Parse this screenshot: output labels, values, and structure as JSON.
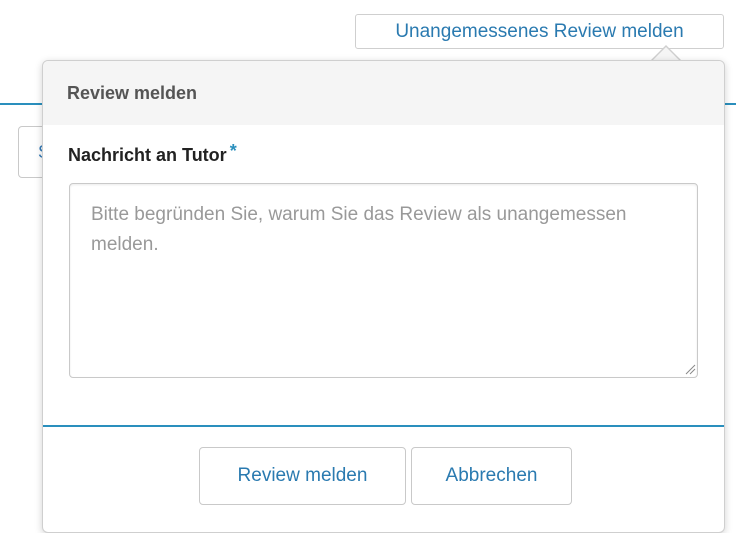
{
  "page": {
    "report_link_label": "Unangemessenes Review melden",
    "background_fragment_char": "S"
  },
  "popover": {
    "title": "Review melden",
    "field_label": "Nachricht an Tutor",
    "required_marker": "*",
    "textarea": {
      "value": "",
      "placeholder": "Bitte begründen Sie, warum Sie das Review als unangemessen melden."
    },
    "buttons": {
      "submit_label": "Review melden",
      "cancel_label": "Abbrechen"
    }
  },
  "colors": {
    "accent": "#2a8fbd",
    "link": "#2a7ab0",
    "header_bg": "#f5f5f5",
    "border": "#cfcfcf"
  }
}
